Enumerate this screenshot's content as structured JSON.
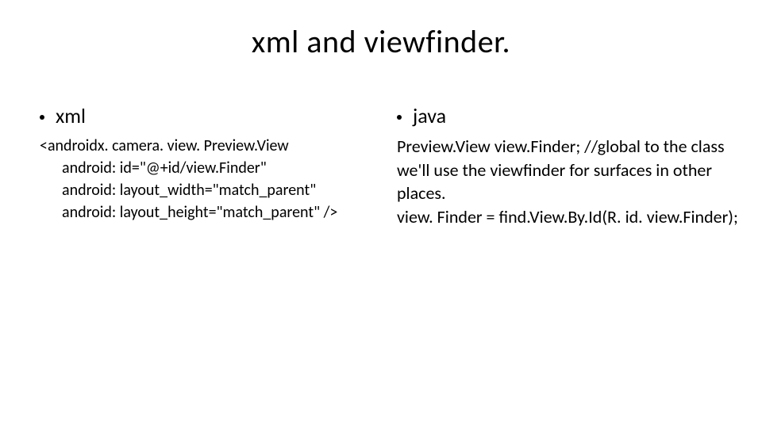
{
  "title": "xml and viewfinder.",
  "left": {
    "heading": "xml",
    "code": {
      "line1": "<androidx. camera. view. Preview.View",
      "line2": "android: id=\"@+id/view.Finder\"",
      "line3": "android: layout_width=\"match_parent\"",
      "line4": "android: layout_height=\"match_parent\" />"
    }
  },
  "right": {
    "heading": "java",
    "body": {
      "line1": "Preview.View view.Finder;  //global to the class",
      "line2": "we'll use the viewfinder for surfaces in other places.",
      "line3": "view. Finder = find.View.By.Id(R. id. view.Finder);"
    }
  }
}
